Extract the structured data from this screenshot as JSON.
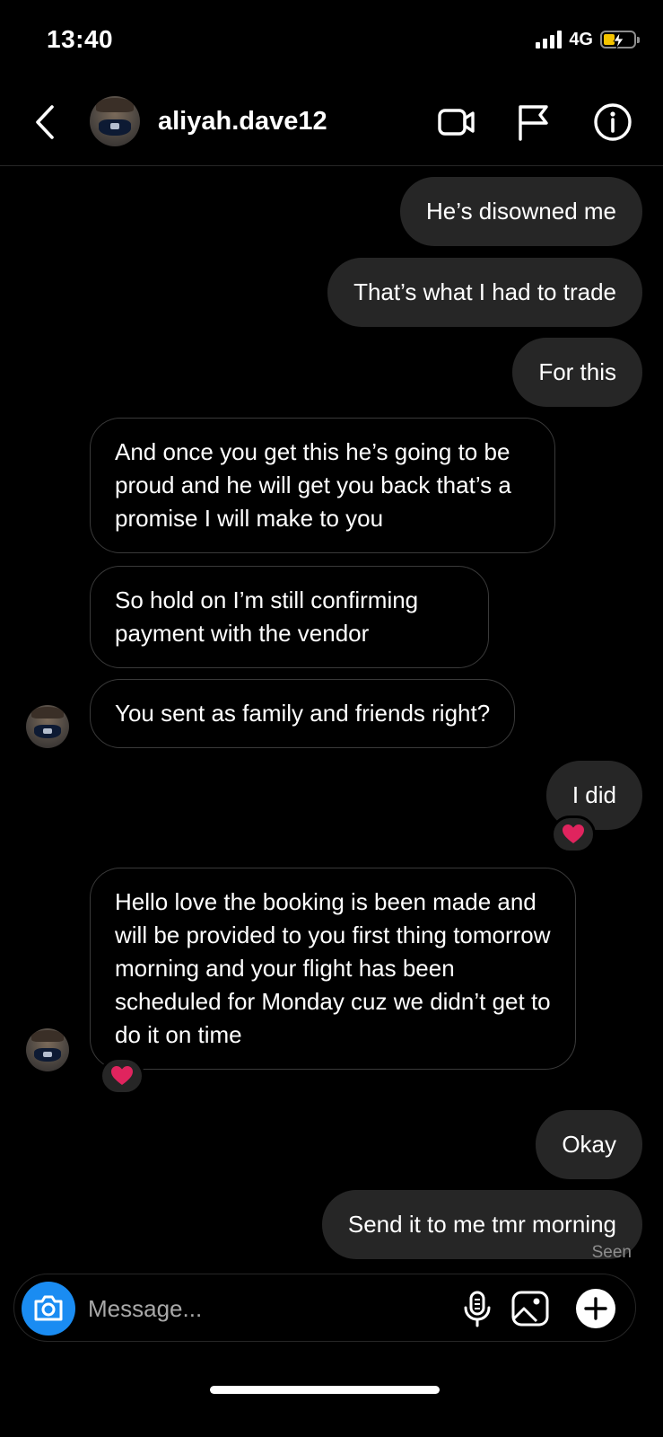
{
  "status": {
    "time": "13:40",
    "network": "4G"
  },
  "header": {
    "username": "aliyah.dave12"
  },
  "icons": {
    "back": "chevron-left-icon",
    "video": "video-call-icon",
    "flag": "flag-icon",
    "info": "info-icon",
    "camera": "camera-icon",
    "mic": "microphone-icon",
    "gallery": "gallery-icon",
    "add": "plus-icon",
    "reaction": "heart-icon"
  },
  "messages": [
    {
      "side": "sent",
      "text": "He’s disowned me"
    },
    {
      "side": "sent",
      "text": "That’s what I had to trade"
    },
    {
      "side": "sent",
      "text": "For this"
    },
    {
      "side": "received",
      "text": "And once you get this he’s going to be proud and he will get you back that’s a promise I will make to you"
    },
    {
      "side": "received",
      "text": "So hold on I’m still confirming payment with the vendor"
    },
    {
      "side": "received",
      "text": "You sent as family and friends right?"
    },
    {
      "side": "sent",
      "text": "I did",
      "reaction": "❤️"
    },
    {
      "side": "received",
      "text": "Hello love the booking is been made and will be provided to you first thing tomorrow morning and your flight has been scheduled for Monday cuz we didn’t get to do it on time",
      "reaction": "❤️"
    },
    {
      "side": "sent",
      "text": "Okay"
    },
    {
      "side": "sent",
      "text": "Send it to me tmr morning"
    }
  ],
  "seen_label": "Seen",
  "composer": {
    "placeholder": "Message..."
  },
  "colors": {
    "background": "#000000",
    "sent_bubble": "#262626",
    "received_border": "#3a3a3a",
    "camera_button": "#1a8cf2",
    "battery": "#f5c400",
    "heart": "#e0245e"
  }
}
